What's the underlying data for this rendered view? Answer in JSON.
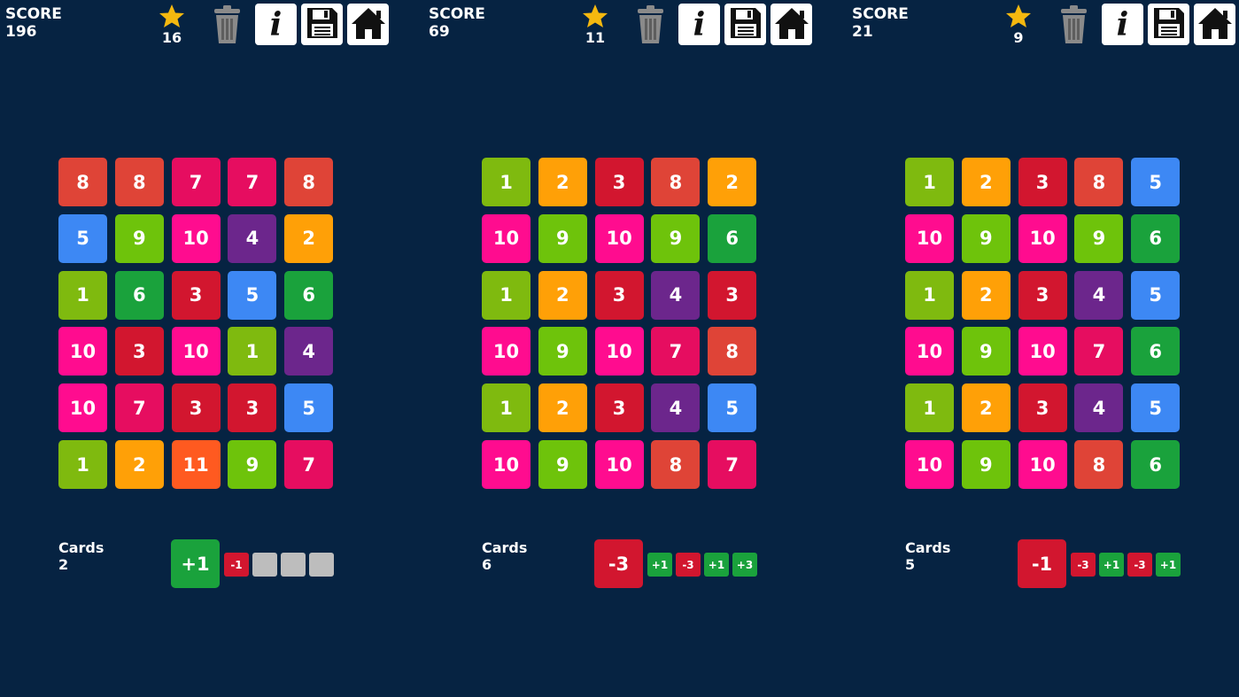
{
  "labels": {
    "score": "SCORE",
    "cards": "Cards"
  },
  "icons": {
    "star": "star-icon",
    "trash": "trash-icon",
    "info": "info-icon",
    "save": "save-icon",
    "home": "home-icon"
  },
  "info_glyph": "i",
  "colors": {
    "background": "#062342",
    "1": "#7fba0f",
    "2": "#ffa007",
    "3": "#d2162f",
    "4": "#6c268c",
    "5": "#3d88f4",
    "6": "#1aa23c",
    "7": "#e60d60",
    "8": "#df4437",
    "9": "#6ec30b",
    "10": "#ff0c8f",
    "11": "#ff5a20",
    "plus_card": "#1aa23c",
    "minus_card": "#d2162f",
    "empty_slot": "#bdbdbd",
    "star": "#f5b80f"
  },
  "panels": [
    {
      "score": "196",
      "stars": "16",
      "grid": [
        [
          "8",
          "8",
          "7",
          "7",
          "8"
        ],
        [
          "5",
          "9",
          "10",
          "4",
          "2"
        ],
        [
          "1",
          "6",
          "3",
          "5",
          "6"
        ],
        [
          "10",
          "3",
          "10",
          "1",
          "4"
        ],
        [
          "10",
          "7",
          "3",
          "3",
          "5"
        ],
        [
          "1",
          "2",
          "11",
          "9",
          "7"
        ]
      ],
      "cards_count": "2",
      "current_card": "+1",
      "queue": [
        "-1",
        "",
        "",
        ""
      ]
    },
    {
      "score": "69",
      "stars": "11",
      "grid": [
        [
          "1",
          "2",
          "3",
          "8",
          "2"
        ],
        [
          "10",
          "9",
          "10",
          "9",
          "6"
        ],
        [
          "1",
          "2",
          "3",
          "4",
          "3"
        ],
        [
          "10",
          "9",
          "10",
          "7",
          "8"
        ],
        [
          "1",
          "2",
          "3",
          "4",
          "5"
        ],
        [
          "10",
          "9",
          "10",
          "8",
          "7"
        ]
      ],
      "cards_count": "6",
      "current_card": "-3",
      "queue": [
        "+1",
        "-3",
        "+1",
        "+3"
      ]
    },
    {
      "score": "21",
      "stars": "9",
      "grid": [
        [
          "1",
          "2",
          "3",
          "8",
          "5"
        ],
        [
          "10",
          "9",
          "10",
          "9",
          "6"
        ],
        [
          "1",
          "2",
          "3",
          "4",
          "5"
        ],
        [
          "10",
          "9",
          "10",
          "7",
          "6"
        ],
        [
          "1",
          "2",
          "3",
          "4",
          "5"
        ],
        [
          "10",
          "9",
          "10",
          "8",
          "6"
        ]
      ],
      "cards_count": "5",
      "current_card": "-1",
      "queue": [
        "-3",
        "+1",
        "-3",
        "+1"
      ]
    }
  ]
}
